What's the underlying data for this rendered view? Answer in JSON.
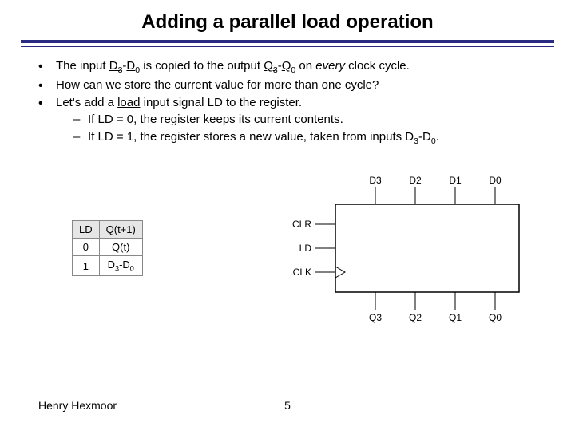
{
  "title": "Adding a parallel load operation",
  "bullets": {
    "b1": {
      "pre": "The input ",
      "d_hi": "D",
      "d_hi_sub": "3",
      "mid1": "-",
      "d_lo": "D",
      "d_lo_sub": "0",
      "mid2": " is copied to the output ",
      "q_hi": "Q",
      "q_hi_sub": "3",
      "mid3": "-",
      "q_lo": "Q",
      "q_lo_sub": "0",
      "mid4": " on ",
      "every": "every",
      "post": " clock cycle."
    },
    "b2": "How can we store the current value for more than one cycle?",
    "b3": {
      "pre": "Let's add a ",
      "load": "load",
      "post": " input signal LD to the register."
    },
    "d1": "If LD = 0, the register keeps its current contents.",
    "d2": {
      "pre": "If LD = 1, the register stores a new value, taken from inputs ",
      "d_hi": "D",
      "d_hi_sub": "3",
      "mid": "-",
      "d_lo": "D",
      "d_lo_sub": "0",
      "post": "."
    }
  },
  "chart_data": {
    "type": "table",
    "headers": [
      "LD",
      "Q(t+1)"
    ],
    "rows": [
      [
        "0",
        "Q(t)"
      ],
      [
        "1",
        "D3-D0"
      ]
    ]
  },
  "diagram": {
    "top_pins": [
      "D3",
      "D2",
      "D1",
      "D0"
    ],
    "left_pins": [
      "CLR",
      "LD",
      "CLK"
    ],
    "bottom_pins": [
      "Q3",
      "Q2",
      "Q1",
      "Q0"
    ]
  },
  "footer": {
    "author": "Henry Hexmoor",
    "page": "5"
  }
}
